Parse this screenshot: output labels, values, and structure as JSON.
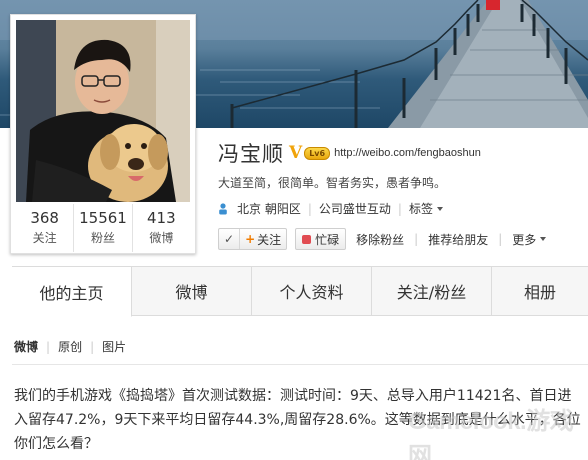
{
  "profile": {
    "name": "冯宝顺",
    "verified_badge": "V",
    "vip_level": "Lv6",
    "url": "http://weibo.com/fengbaoshun",
    "bio": "大道至简，很简单。智者务实，愚者争鸣。",
    "location": "北京 朝阳区",
    "company": "公司盛世互动",
    "tags_label": "标签"
  },
  "stats": [
    {
      "value": "368",
      "label": "关注"
    },
    {
      "value": "15561",
      "label": "粉丝"
    },
    {
      "value": "413",
      "label": "微博"
    }
  ],
  "actions": {
    "followed_check": "✓",
    "follow_label": "关注",
    "busy_label": "忙碌",
    "remove_fan_label": "移除粉丝",
    "recommend_label": "推荐给朋友",
    "more_label": "更多"
  },
  "tabs": [
    "他的主页",
    "微博",
    "个人资料",
    "关注/粉丝",
    "相册"
  ],
  "subnav": [
    "微博",
    "原创",
    "图片"
  ],
  "post": {
    "text": "我们的手机游戏《捣捣塔》首次测试数据：测试时间：9天、总导入用户11421名、首日进入留存47.2%，9天下来平均日留存44.3%,周留存28.6%。这等数据到底是什么水平，各位你们怎么看？"
  },
  "watermark": "Gamelook.游戏网",
  "colors": {
    "accent_orange": "#f17c00",
    "busy_red": "#e14c52",
    "vip_gold": "#f0a30a",
    "location_blue": "#3b8fd1"
  },
  "icons": {
    "location": "map-pin-icon",
    "caret": "chevron-down-icon",
    "plus": "plus-icon",
    "busy": "busy-status-icon",
    "check": "check-icon"
  }
}
